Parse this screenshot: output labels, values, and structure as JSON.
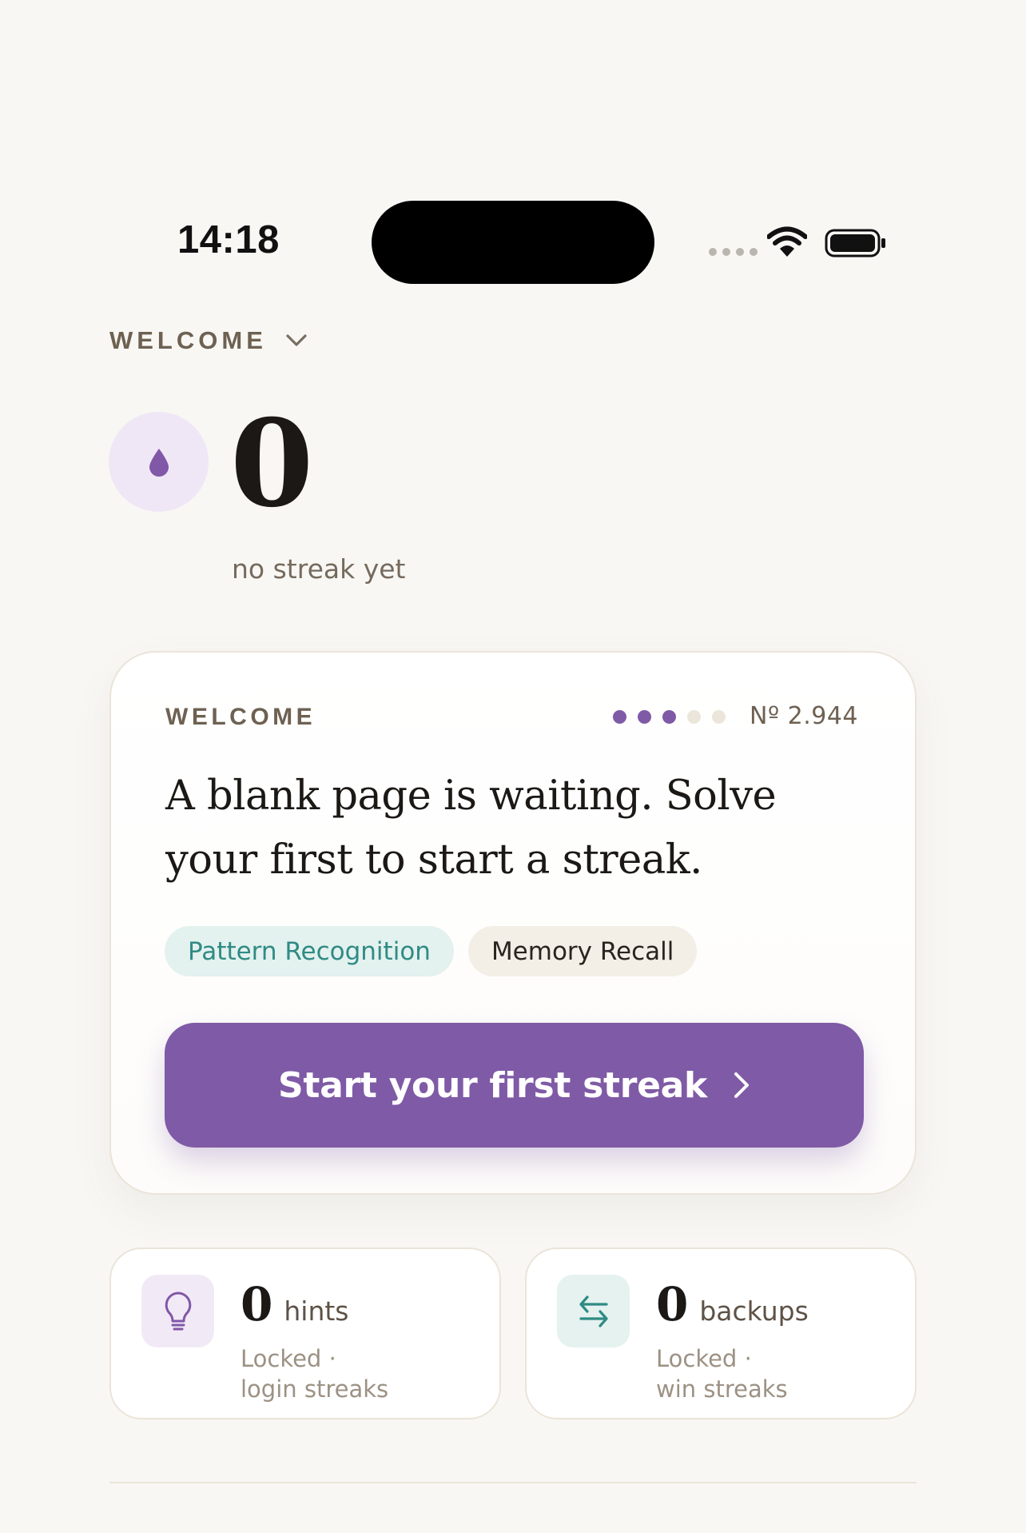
{
  "status_bar": {
    "time": "14:18",
    "icons": [
      "cellular-signal-icon",
      "wifi-icon",
      "battery-icon"
    ]
  },
  "header": {
    "dropdown_label": "WELCOME",
    "dropdown_icon": "chevron-down-icon"
  },
  "streak": {
    "icon": "drop-icon",
    "count": "0",
    "caption": "no streak yet"
  },
  "card": {
    "eyebrow": "WELCOME",
    "progress": {
      "filled": 3,
      "total": 5
    },
    "puzzle_number": "Nº 2.944",
    "heading": "A blank page is waiting. Solve your first to start a streak.",
    "tags": [
      "Pattern Recognition",
      "Memory Recall"
    ],
    "cta_label": "Start your first streak",
    "cta_icon": "chevron-right-icon"
  },
  "stats": [
    {
      "icon": "lightbulb-icon",
      "count": "0",
      "unit": "hints",
      "status_line1": "Locked ·",
      "status_line2": "login streaks"
    },
    {
      "icon": "swap-arrows-icon",
      "count": "0",
      "unit": "backups",
      "status_line1": "Locked ·",
      "status_line2": "win streaks"
    }
  ],
  "colors": {
    "background": "#f8f7f4",
    "accent": "#7f5aa6",
    "accent_soft": "#efe7f6",
    "teal": "#2f8b84",
    "teal_soft": "#e3f1ef",
    "text_primary": "#1b1815",
    "text_muted": "#6e6152",
    "dot_inactive": "#ece6da"
  }
}
